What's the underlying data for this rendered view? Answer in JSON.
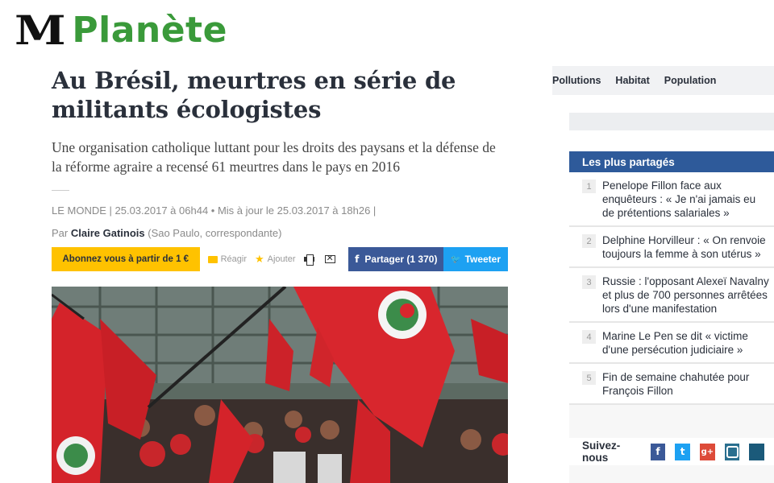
{
  "brand": {
    "logo": "M",
    "section": "Planète"
  },
  "article": {
    "headline": "Au Brésil, meurtres en série de militants écologistes",
    "lede": "Une organisation catholique luttant pour les droits des paysans et la défense de la réforme agraire a recensé 61 meurtres dans le pays en 2016",
    "meta": "LE MONDE | 25.03.2017 à 06h44 • Mis à jour le 25.03.2017 à 18h26 |",
    "byline_prefix": "Par",
    "author": "Claire Gatinois",
    "byline_suffix": "(Sao Paulo, correspondante)"
  },
  "share_bar": {
    "subscribe": "Abonnez vous à partir de 1 €",
    "react": "Réagir",
    "add": "Ajouter",
    "facebook": "Partager (1 370)",
    "twitter": "Tweeter"
  },
  "topnav": {
    "items": [
      "Pollutions",
      "Habitat",
      "Population"
    ]
  },
  "most_shared": {
    "title": "Les plus partagés",
    "items": [
      {
        "num": "1",
        "text": "Penelope Fillon face aux enquêteurs : « Je n'ai jamais eu de prétentions salariales »"
      },
      {
        "num": "2",
        "text": "Delphine Horvilleur : « On renvoie toujours la femme à son utérus »"
      },
      {
        "num": "3",
        "text": "Russie : l'opposant Alexeï Navalny et plus de 700 personnes arrêtées lors d'une manifestation"
      },
      {
        "num": "4",
        "text": "Marine Le Pen se dit « victime d'une persécution judiciaire »"
      },
      {
        "num": "5",
        "text": "Fin de semaine chahutée pour François Fillon"
      }
    ]
  },
  "follow": {
    "label": "Suivez-nous"
  },
  "colors": {
    "section_green": "#3a9a3a",
    "subscribe_yellow": "#ffc200",
    "facebook": "#3b5998",
    "twitter": "#1da1f2",
    "box_header": "#2e5a9a"
  },
  "icons": [
    "comment-icon",
    "star-icon",
    "print-icon",
    "mail-icon",
    "facebook-icon",
    "twitter-icon",
    "googleplus-icon",
    "instagram-icon"
  ]
}
